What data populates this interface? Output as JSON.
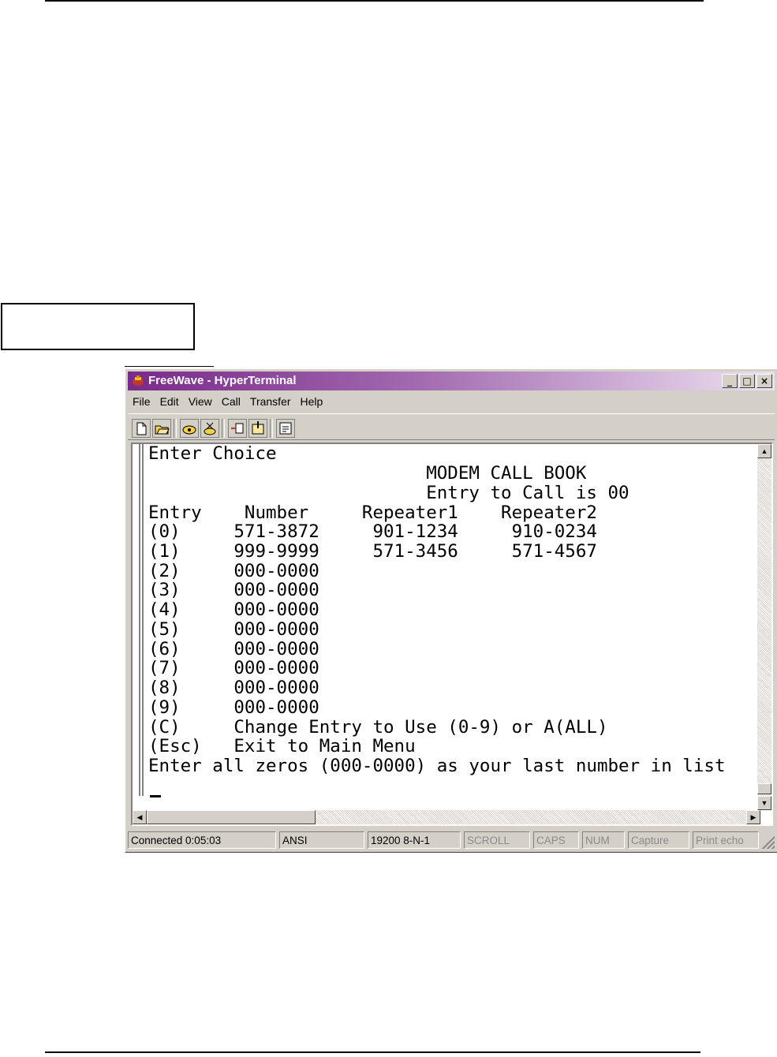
{
  "window": {
    "title": "FreeWave - HyperTerminal"
  },
  "menu": [
    "File",
    "Edit",
    "View",
    "Call",
    "Transfer",
    "Help"
  ],
  "toolbar": {
    "buttons": [
      "new-document-icon",
      "open-folder-icon",
      "phone-connect-icon",
      "phone-disconnect-icon",
      "send-file-icon",
      "receive-file-icon",
      "properties-icon"
    ]
  },
  "terminal": {
    "lines": [
      "Enter Choice",
      "                          MODEM CALL BOOK",
      "                          Entry to Call is 00",
      "Entry    Number     Repeater1    Repeater2",
      "(0)     571-3872     901-1234     910-0234",
      "(1)     999-9999     571-3456     571-4567",
      "(2)     000-0000",
      "(3)     000-0000",
      "(4)     000-0000",
      "(5)     000-0000",
      "(6)     000-0000",
      "(7)     000-0000",
      "(8)     000-0000",
      "(9)     000-0000",
      "(C)     Change Entry to Use (0-9) or A(ALL)",
      "(Esc)   Exit to Main Menu",
      "Enter all zeros (000-0000) as your last number in list"
    ]
  },
  "status": {
    "connected": "Connected 0:05:03",
    "emulation": "ANSI",
    "port_settings": "19200 8-N-1",
    "scroll": "SCROLL",
    "caps": "CAPS",
    "num": "NUM",
    "capture": "Capture",
    "print_echo": "Print echo"
  }
}
